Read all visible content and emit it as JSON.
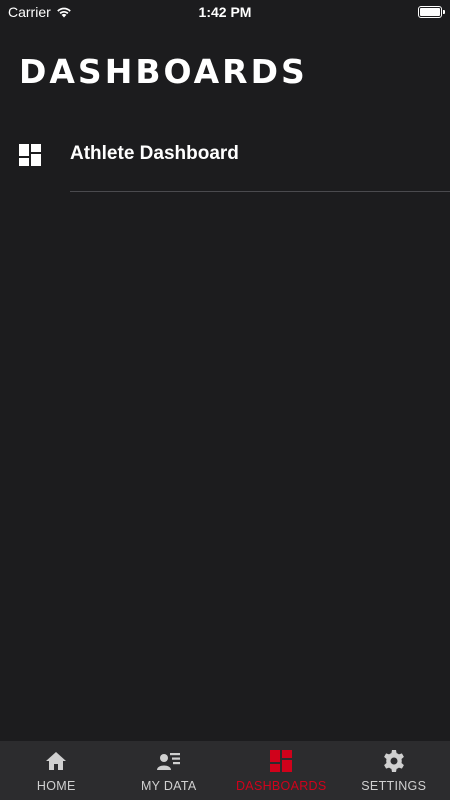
{
  "status_bar": {
    "carrier": "Carrier",
    "time": "1:42 PM",
    "battery_level": 1.0
  },
  "header": {
    "title": "DASHBOARDS"
  },
  "dashboards": {
    "items": [
      {
        "label": "Athlete Dashboard",
        "icon": "dashboard-icon"
      }
    ]
  },
  "tab_bar": {
    "tabs": [
      {
        "label": "HOME",
        "icon": "home-icon",
        "active": false
      },
      {
        "label": "MY DATA",
        "icon": "user-list-icon",
        "active": false
      },
      {
        "label": "DASHBOARDS",
        "icon": "dashboard-icon",
        "active": true
      },
      {
        "label": "SETTINGS",
        "icon": "gear-icon",
        "active": false
      }
    ]
  },
  "colors": {
    "background": "#1c1c1e",
    "tab_bar_background": "#2c2c2e",
    "accent": "#d0021b",
    "inactive_tab": "#d0d0d0",
    "text": "#ffffff"
  }
}
